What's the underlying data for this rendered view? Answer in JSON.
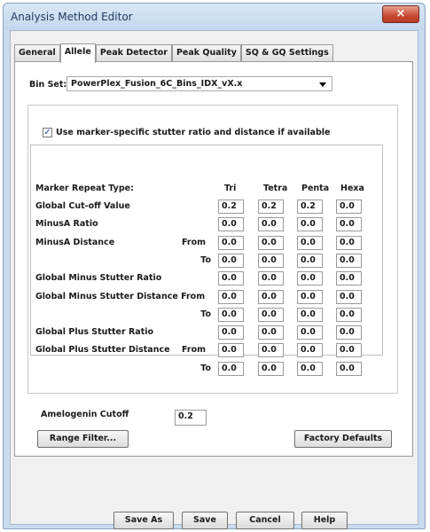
{
  "window": {
    "title": "Analysis Method Editor",
    "close_glyph": "×"
  },
  "tabs": [
    {
      "label": "General",
      "active": false
    },
    {
      "label": "Allele",
      "active": true
    },
    {
      "label": "Peak Detector",
      "active": false
    },
    {
      "label": "Peak Quality",
      "active": false
    },
    {
      "label": "SQ & GQ Settings",
      "active": false
    }
  ],
  "bin_set": {
    "label": "Bin Set:",
    "value": "PowerPlex_Fusion_6C_Bins_IDX_vX.x"
  },
  "marker_specific": {
    "checked": true,
    "check_glyph": "✓",
    "label": "Use marker-specific stutter ratio and distance if available"
  },
  "grid": {
    "header": "Marker Repeat Type:",
    "columns": [
      "Tri",
      "Tetra",
      "Penta",
      "Hexa"
    ],
    "rows": [
      {
        "label": "Global Cut-off Value",
        "sub": "",
        "values": [
          "0.2",
          "0.2",
          "0.2",
          "0.0"
        ]
      },
      {
        "label": "MinusA Ratio",
        "sub": "",
        "values": [
          "0.0",
          "0.0",
          "0.0",
          "0.0"
        ]
      },
      {
        "label": "MinusA Distance",
        "sub": "From",
        "values": [
          "0.0",
          "0.0",
          "0.0",
          "0.0"
        ]
      },
      {
        "label": "",
        "sub": "To",
        "values": [
          "0.0",
          "0.0",
          "0.0",
          "0.0"
        ]
      },
      {
        "label": "Global Minus Stutter Ratio",
        "sub": "",
        "values": [
          "0.0",
          "0.0",
          "0.0",
          "0.0"
        ]
      },
      {
        "label": "Global Minus Stutter Distance From",
        "sub": "",
        "values": [
          "0.0",
          "0.0",
          "0.0",
          "0.0"
        ]
      },
      {
        "label": "",
        "sub": "To",
        "values": [
          "0.0",
          "0.0",
          "0.0",
          "0.0"
        ]
      },
      {
        "label": "Global Plus Stutter Ratio",
        "sub": "",
        "values": [
          "0.0",
          "0.0",
          "0.0",
          "0.0"
        ]
      },
      {
        "label": "Global Plus Stutter Distance",
        "sub": "From",
        "values": [
          "0.0",
          "0.0",
          "0.0",
          "0.0"
        ]
      },
      {
        "label": "",
        "sub": "To",
        "values": [
          "0.0",
          "0.0",
          "0.0",
          "0.0"
        ]
      }
    ]
  },
  "amelogenin": {
    "label": "Amelogenin Cutoff",
    "value": "0.2"
  },
  "buttons": {
    "range_filter": "Range Filter...",
    "factory_defaults": "Factory Defaults",
    "save_as": "Save As",
    "save": "Save",
    "cancel": "Cancel",
    "help": "Help"
  }
}
